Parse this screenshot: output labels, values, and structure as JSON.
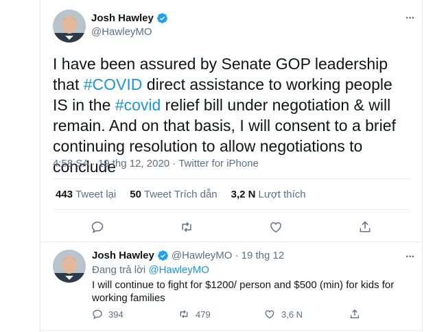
{
  "main_tweet": {
    "author": "Josh Hawley",
    "handle": "@HawleyMO",
    "text_parts": [
      "I have been assured by Senate GOP leadership that ",
      "#COVID",
      " direct assistance to working people IS in the ",
      "#covid",
      " relief bill under negotiation & will remain. And on that basis, I will consent to a brief continuing resolution to allow negotiations to conclude"
    ],
    "timestamp": "4:58 SA · 19 thg 12, 2020 · Twitter for iPhone",
    "stats": {
      "retweets_count": "443",
      "retweets_label": "Tweet lại",
      "quotes_count": "50",
      "quotes_label": "Tweet Trích dẫn",
      "likes_count": "3,2 N",
      "likes_label": "Lượt thích"
    }
  },
  "reply_tweet": {
    "author": "Josh Hawley",
    "handle": "@HawleyMO",
    "date": "· 19 thg 12",
    "replying_to_prefix": "Đang trả lời ",
    "replying_to_handle": "@HawleyMO",
    "text": "I will continue to fight for $1200/ person and $500 (min) for kids for working families",
    "counts": {
      "replies": "394",
      "retweets": "479",
      "likes": "3,6 N"
    }
  },
  "colors": {
    "accent": "#1b95e0",
    "secondary_text": "#5b7083",
    "divider": "#e6ecf0"
  },
  "icons": [
    "verified-badge-icon",
    "more-icon",
    "reply-icon",
    "retweet-icon",
    "like-icon",
    "share-icon"
  ]
}
